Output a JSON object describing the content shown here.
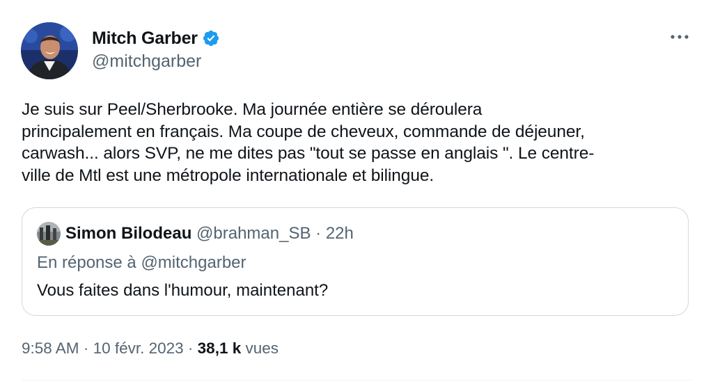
{
  "tweet": {
    "author": {
      "display_name": "Mitch Garber",
      "handle": "@mitchgarber",
      "verified": true,
      "verified_color": "#1d9bf0"
    },
    "more_icon": "more-dots-icon",
    "text": "Je suis sur Peel/Sherbrooke. Ma journée entière se déroulera\nprincipalement en français. Ma coupe de cheveux, commande de déjeuner,\ncarwash... alors SVP, ne me dites pas \"tout se passe en anglais \". Le centre-\nville de Mtl est une métropole internationale et bilingue.",
    "quote": {
      "display_name": "Simon Bilodeau",
      "handle": "@brahman_SB",
      "separator": " · ",
      "time": "22h",
      "reply_to": "En réponse à @mitchgarber",
      "text": "Vous faites dans l'humour, maintenant?"
    },
    "meta": {
      "time": "9:58 AM",
      "separator": " · ",
      "date": "10 févr. 2023",
      "views_count": "38,1 k",
      "views_label": "vues"
    }
  },
  "colors": {
    "text": "#0f1419",
    "secondary": "#536471",
    "border": "#cfd9de"
  }
}
